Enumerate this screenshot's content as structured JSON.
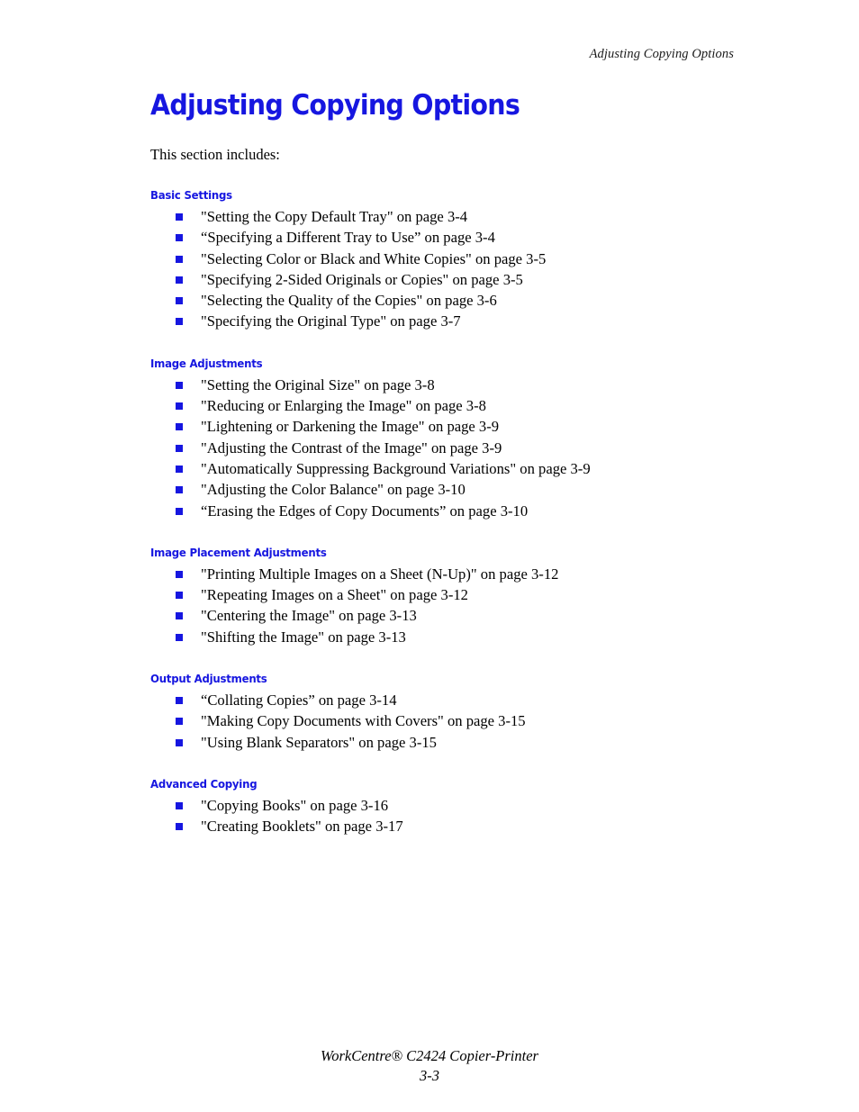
{
  "header": {
    "running_head": "Adjusting Copying Options"
  },
  "main": {
    "title": "Adjusting Copying Options",
    "intro": "This section includes:",
    "sections": [
      {
        "heading": "Basic Settings",
        "items": [
          "\"Setting the Copy Default Tray\" on page 3-4",
          "“Specifying a Different Tray to Use” on page 3-4",
          "\"Selecting Color or Black and White Copies\" on page 3-5",
          "\"Specifying 2-Sided Originals or Copies\" on page 3-5",
          "\"Selecting the Quality of the Copies\" on page 3-6",
          "\"Specifying the Original Type\" on page 3-7"
        ]
      },
      {
        "heading": "Image Adjustments",
        "items": [
          "\"Setting the Original Size\" on page 3-8",
          "\"Reducing or Enlarging the Image\" on page 3-8",
          "\"Lightening or Darkening the Image\" on page 3-9",
          "\"Adjusting the Contrast of the Image\" on page 3-9",
          "\"Automatically Suppressing Background Variations\" on page 3-9",
          "\"Adjusting the Color Balance\" on page 3-10",
          "“Erasing the Edges of Copy Documents” on page 3-10"
        ]
      },
      {
        "heading": "Image Placement Adjustments",
        "items": [
          "\"Printing Multiple Images on a Sheet (N-Up)\" on page 3-12",
          "\"Repeating Images on a Sheet\" on page 3-12",
          "\"Centering the Image\" on page 3-13",
          "\"Shifting the Image\" on page 3-13"
        ]
      },
      {
        "heading": "Output Adjustments",
        "items": [
          "“Collating Copies” on page 3-14",
          "\"Making Copy Documents with Covers\" on page 3-15",
          "\"Using Blank Separators\" on page 3-15"
        ]
      },
      {
        "heading": "Advanced Copying",
        "items": [
          "\"Copying Books\" on page 3-16",
          "\"Creating Booklets\" on page 3-17"
        ]
      }
    ]
  },
  "footer": {
    "product": "WorkCentre® C2424 Copier-Printer",
    "page_number": "3-3"
  },
  "colors": {
    "heading_blue": "#1616e0",
    "bullet_blue": "#1616e0",
    "body_text": "#000000",
    "page_background": "#ffffff"
  }
}
